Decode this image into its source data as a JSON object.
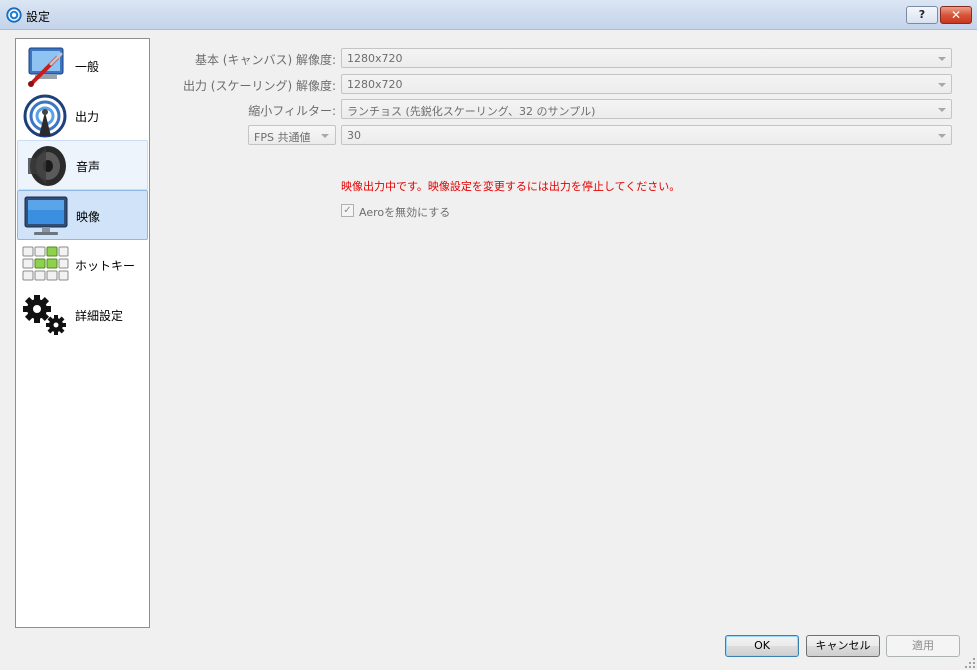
{
  "window": {
    "title": "設定",
    "help_label": "?",
    "close_label": "✕"
  },
  "sidebar": {
    "items": [
      {
        "label": "一般",
        "icon": "wrench-screwdriver-icon"
      },
      {
        "label": "出力",
        "icon": "broadcast-antenna-icon"
      },
      {
        "label": "音声",
        "icon": "speaker-icon"
      },
      {
        "label": "映像",
        "icon": "monitor-icon"
      },
      {
        "label": "ホットキー",
        "icon": "hotkeys-grid-icon"
      },
      {
        "label": "詳細設定",
        "icon": "gears-icon"
      }
    ],
    "selected": "映像"
  },
  "form": {
    "base_resolution": {
      "label": "基本 (キャンバス) 解像度:",
      "value": "1280x720"
    },
    "output_resolution": {
      "label": "出力 (スケーリング) 解像度:",
      "value": "1280x720"
    },
    "downscale_filter": {
      "label": "縮小フィルター:",
      "value": "ランチョス (先鋭化スケーリング、32 のサンプル)"
    },
    "fps": {
      "type_value": "FPS 共通値",
      "value": "30"
    },
    "warning": "映像出力中です。映像設定を変更するには出力を停止してください。",
    "disable_aero": {
      "label": "Aeroを無効にする",
      "checked": true,
      "check_glyph": "✓"
    }
  },
  "buttons": {
    "ok": "OK",
    "cancel": "キャンセル",
    "apply": "適用"
  },
  "colors": {
    "warning": "#e60000",
    "selection": "#d0e3f8",
    "disabled_text": "#6d6d6d"
  }
}
